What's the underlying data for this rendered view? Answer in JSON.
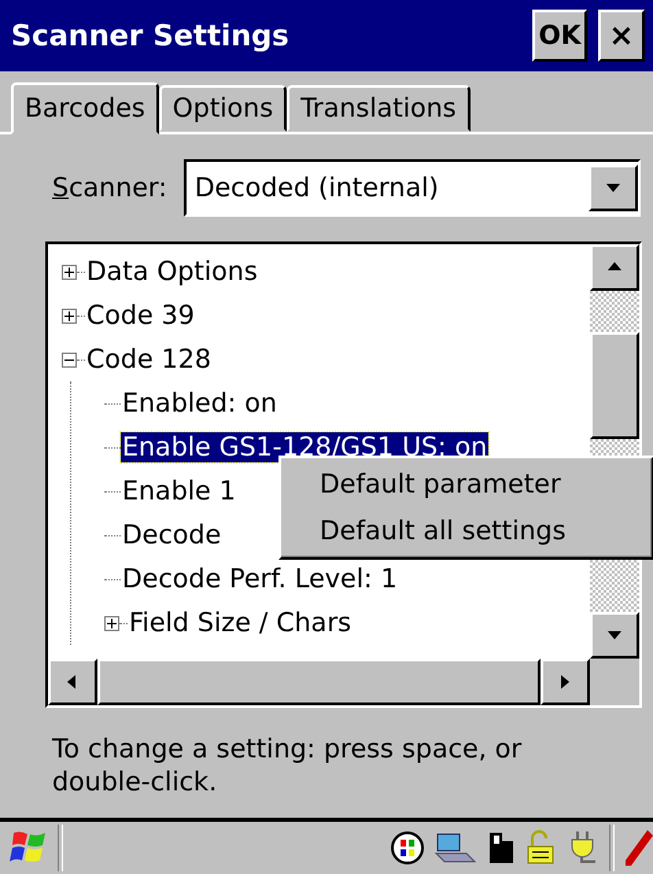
{
  "window": {
    "title": "Scanner Settings",
    "buttons": [
      {
        "kind": "ok",
        "label": "OK"
      },
      {
        "kind": "close",
        "label": "×"
      }
    ]
  },
  "tabs": [
    {
      "label": "Barcodes",
      "selected": true
    },
    {
      "label": "Options",
      "selected": false
    },
    {
      "label": "Translations",
      "selected": false
    }
  ],
  "scanner": {
    "label": "Scanner:",
    "value": "Decoded (internal)"
  },
  "tree": [
    {
      "label": "Data Options",
      "expanded": false,
      "selected": false
    },
    {
      "label": "Code 39",
      "expanded": false,
      "selected": false
    },
    {
      "label": "Code 128",
      "expanded": true,
      "selected": false,
      "children": [
        {
          "label": "Enabled: on",
          "selected": false
        },
        {
          "label": "Enable GS1-128/GS1 US: on",
          "selected": true
        },
        {
          "label": "Enable 1",
          "selected": false
        },
        {
          "label": "Decode",
          "selected": false
        },
        {
          "label": "Decode Perf. Level: 1",
          "selected": false
        },
        {
          "label": "Field Size / Chars",
          "expanded": false,
          "selected": false
        }
      ]
    }
  ],
  "context_menu": [
    "Default parameter",
    "Default all settings"
  ],
  "hint": "To change a setting: press space, or double-click."
}
